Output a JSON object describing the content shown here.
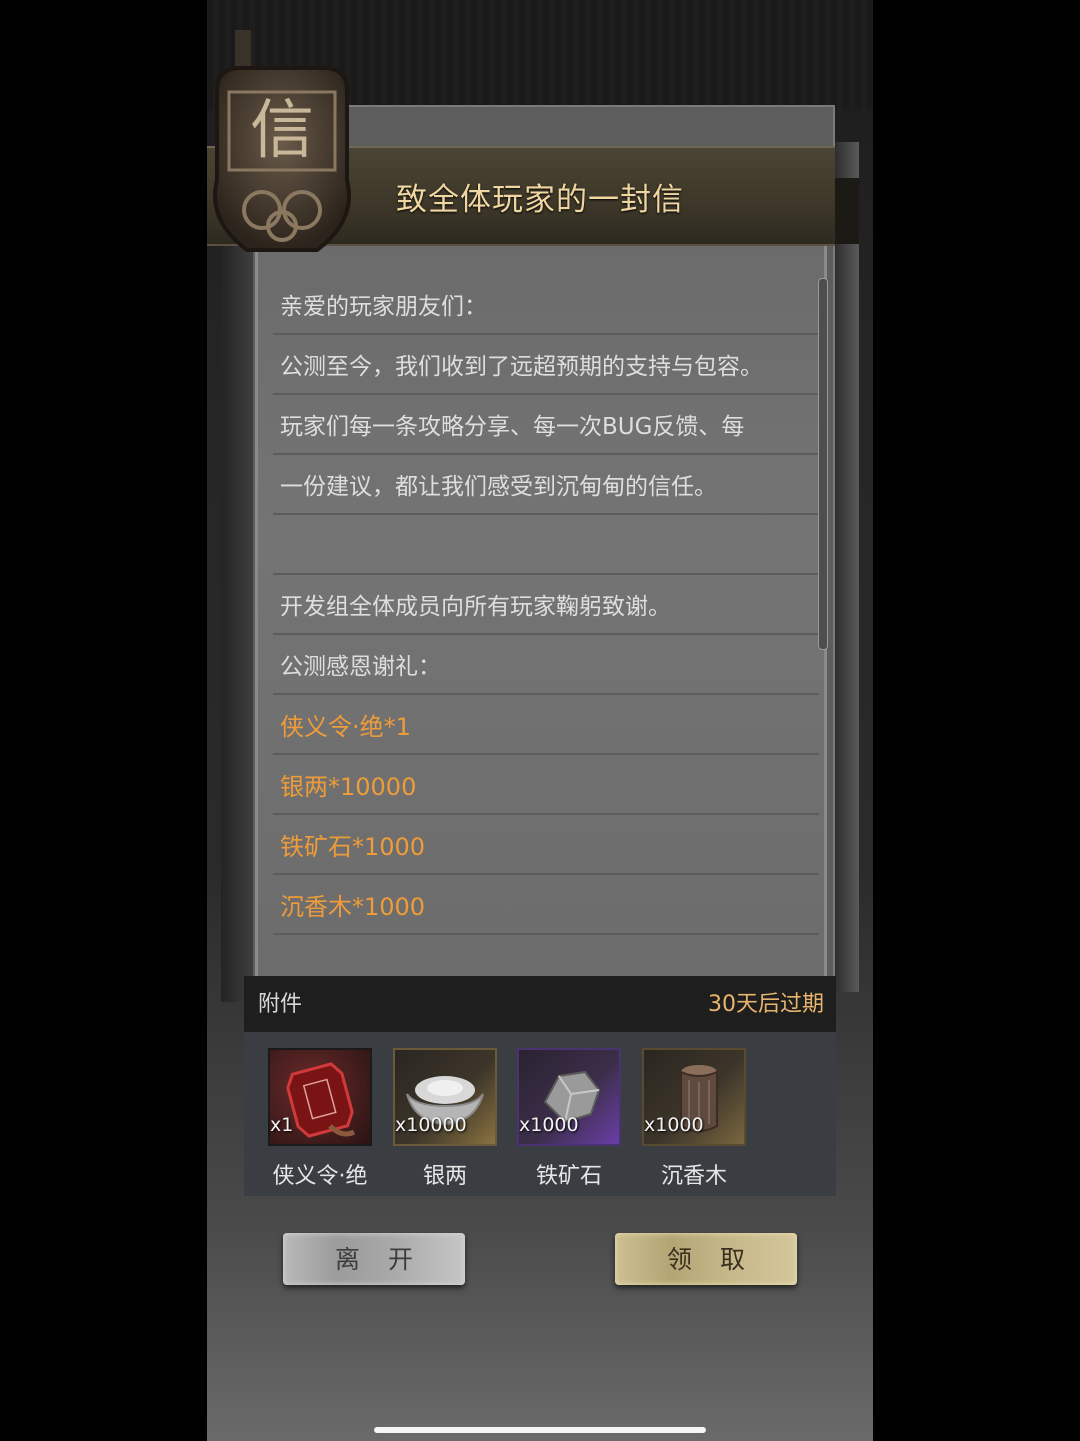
{
  "letter": {
    "title": "致全体玩家的一封信",
    "seal_character": "信",
    "lines": [
      "亲爱的玩家朋友们：",
      "公测至今，我们收到了远超预期的支持与包容。",
      "玩家们每一条攻略分享、每一次BUG反馈、每",
      "一份建议，都让我们感受到沉甸甸的信任。",
      "",
      "开发组全体成员向所有玩家鞠躬致谢。",
      "公测感恩谢礼："
    ],
    "rewards": [
      "侠义令·绝*1",
      "银两*10000",
      "铁矿石*1000",
      "沉香木*1000"
    ]
  },
  "attachments": {
    "label": "附件",
    "expire": "30天后过期",
    "items": [
      {
        "name": "侠义令·绝",
        "count": "x1",
        "icon": "token-plaque-icon",
        "rarity_color": "#c0392b"
      },
      {
        "name": "银两",
        "count": "x10000",
        "icon": "silver-ingot-icon",
        "rarity_color": "#b8953a"
      },
      {
        "name": "铁矿石",
        "count": "x1000",
        "icon": "iron-ore-icon",
        "rarity_color": "#6a3ea8"
      },
      {
        "name": "沉香木",
        "count": "x1000",
        "icon": "agarwood-log-icon",
        "rarity_color": "#a08040"
      }
    ]
  },
  "buttons": {
    "leave": "离开",
    "claim": "领取"
  },
  "colors": {
    "reward_text": "#ee9c3a",
    "title_text": "#f0d6a0",
    "expire_text": "#e8b56c"
  }
}
